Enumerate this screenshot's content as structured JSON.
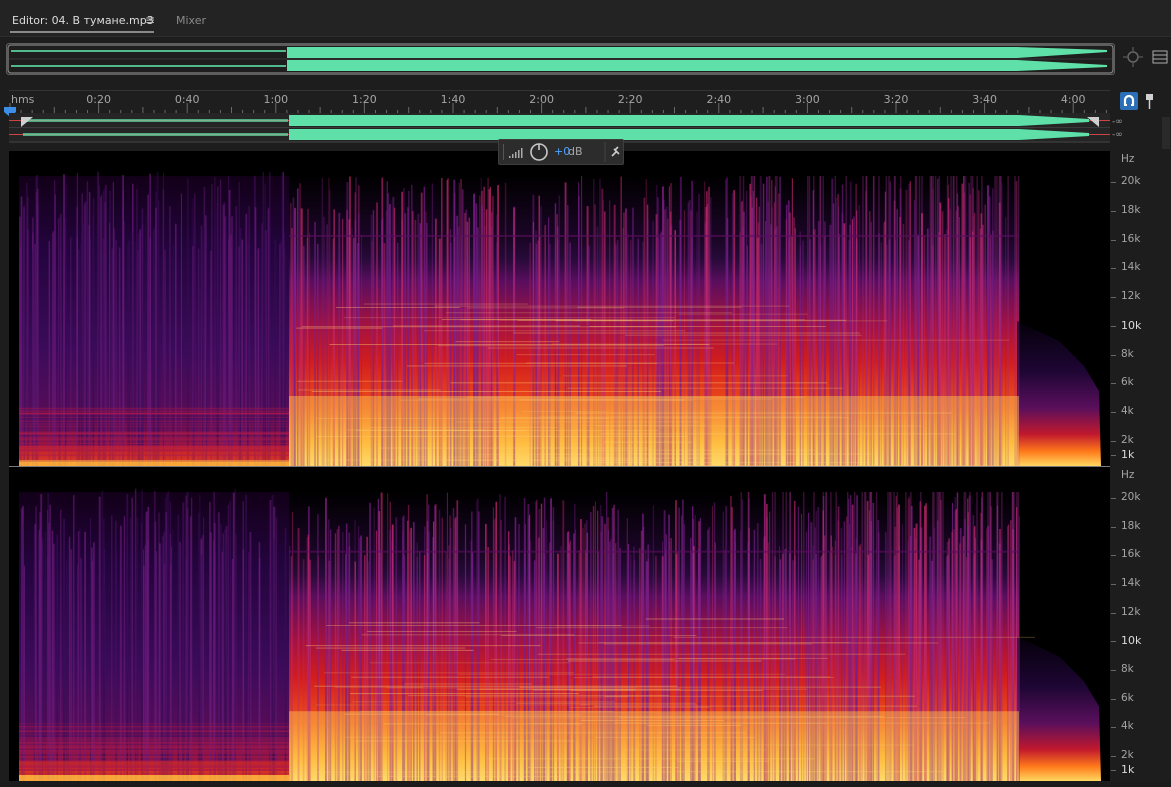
{
  "tabs": {
    "editor_label": "Editor: 04. В тумане.mp3",
    "mixer_label": "Mixer",
    "menu_glyph": "≡"
  },
  "ruler": {
    "unit": "hms",
    "ticks": [
      "0:20",
      "0:40",
      "1:00",
      "1:20",
      "1:40",
      "2:00",
      "2:20",
      "2:40",
      "3:00",
      "3:20",
      "3:40",
      "4:00"
    ]
  },
  "meters": {
    "left_label": "-∞",
    "right_label": "-∞"
  },
  "hud": {
    "value": "+0",
    "unit": "dB"
  },
  "frequency_scale": {
    "unit": "Hz",
    "labels": [
      "20k",
      "18k",
      "16k",
      "14k",
      "12k",
      "10k",
      "8k",
      "6k",
      "4k",
      "2k",
      "1k"
    ]
  },
  "icons": {
    "zoom": "zoom-to-selection-icon",
    "panel": "panel-menu-icon",
    "snap": "magnet-snap-icon",
    "marker": "marker-pin-icon",
    "playhead": "playhead-icon",
    "hud_volume": "volume-bars-icon",
    "hud_knob": "volume-knob-icon",
    "hud_pin": "pin-icon"
  },
  "colors": {
    "waveform": "#5fe0a8",
    "accent": "#4ea2ff",
    "spectro_low": "#2a0a3a",
    "spectro_mid": "#c8123a",
    "spectro_high": "#ffd860"
  }
}
